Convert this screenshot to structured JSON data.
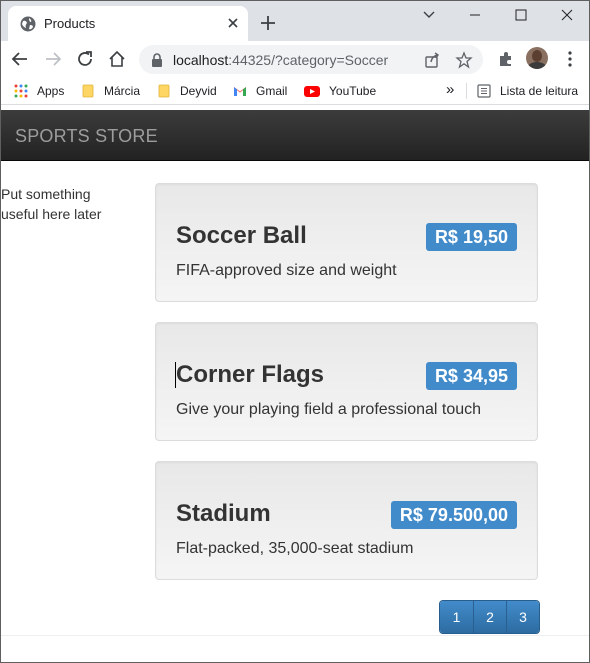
{
  "browser": {
    "tab_title": "Products",
    "url_host": "localhost",
    "url_rest": ":44325/?category=Soccer",
    "bookmarks": [
      "Apps",
      "Márcia",
      "Deyvid",
      "Gmail",
      "YouTube"
    ],
    "reading_list": "Lista de leitura",
    "more_bookmarks": "»"
  },
  "navbar": {
    "brand": "SPORTS STORE"
  },
  "sidebar": {
    "text": "Put something useful here later"
  },
  "products": [
    {
      "name": "Soccer Ball",
      "price": "R$ 19,50",
      "description": "FIFA-approved size and weight"
    },
    {
      "name": "Corner Flags",
      "price": "R$ 34,95",
      "description": "Give your playing field a professional touch"
    },
    {
      "name": "Stadium",
      "price": "R$ 79.500,00",
      "description": "Flat-packed, 35,000-seat stadium"
    }
  ],
  "pagination": [
    "1",
    "2",
    "3"
  ],
  "colors": {
    "accent": "#428bca",
    "navbar": "#222222",
    "card": "#eeeeee"
  }
}
